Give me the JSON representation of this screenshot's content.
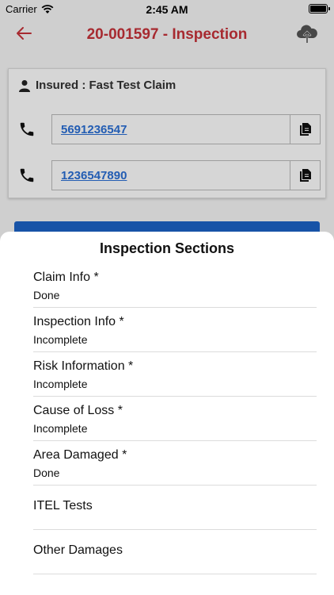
{
  "status_bar": {
    "carrier": "Carrier",
    "time": "2:45 AM"
  },
  "nav": {
    "title": "20-001597 - Inspection"
  },
  "insured": {
    "label": "Insured : Fast Test Claim",
    "phones": [
      "5691236547",
      "1236547890"
    ]
  },
  "sheet": {
    "title": "Inspection Sections",
    "items": [
      {
        "name": "Claim Info *",
        "status": "Done"
      },
      {
        "name": "Inspection Info *",
        "status": "Incomplete"
      },
      {
        "name": "Risk Information *",
        "status": "Incomplete"
      },
      {
        "name": "Cause of Loss *",
        "status": "Incomplete"
      },
      {
        "name": "Area Damaged *",
        "status": "Done"
      },
      {
        "name": "ITEL Tests"
      },
      {
        "name": "Other Damages"
      }
    ]
  },
  "colors": {
    "title_red": "#c8333a",
    "link_blue": "#2a6fd6",
    "primary_blue": "#1c63c7"
  },
  "icons": [
    "back-arrow-icon",
    "cloud-upload-icon",
    "person-icon",
    "phone-icon",
    "copy-icon",
    "wifi-icon",
    "battery-icon"
  ]
}
